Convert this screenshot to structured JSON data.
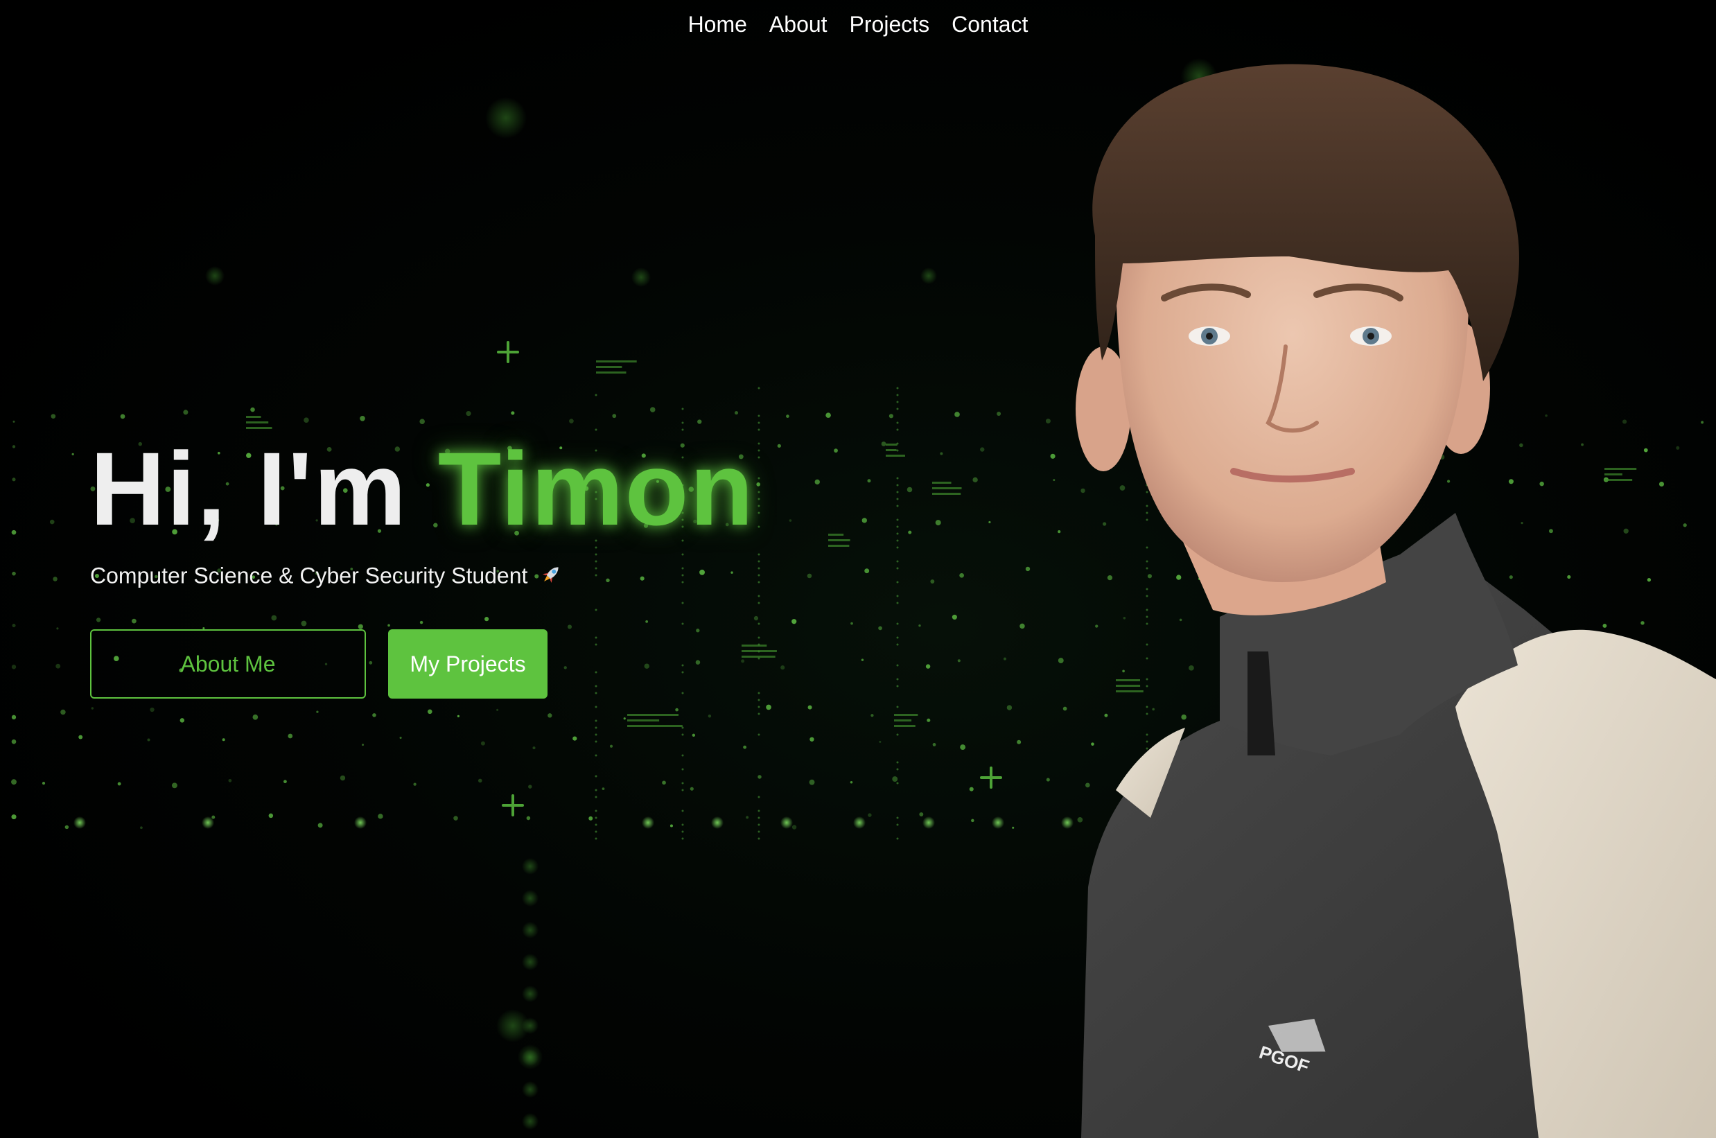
{
  "nav": {
    "items": [
      "Home",
      "About",
      "Projects",
      "Contact"
    ]
  },
  "hero": {
    "greeting": "Hi, I'm ",
    "name": "Timon",
    "subtitle": "Computer Science & Cyber Security Student",
    "subtitle_icon": "rocket-icon"
  },
  "buttons": {
    "about": "About Me",
    "projects": "My Projects"
  },
  "portrait": {
    "icon": "portrait-photo",
    "logo_text": "PGOF"
  },
  "colors": {
    "accent": "#5ec33f",
    "background": "#000000",
    "text": "#ffffff"
  }
}
